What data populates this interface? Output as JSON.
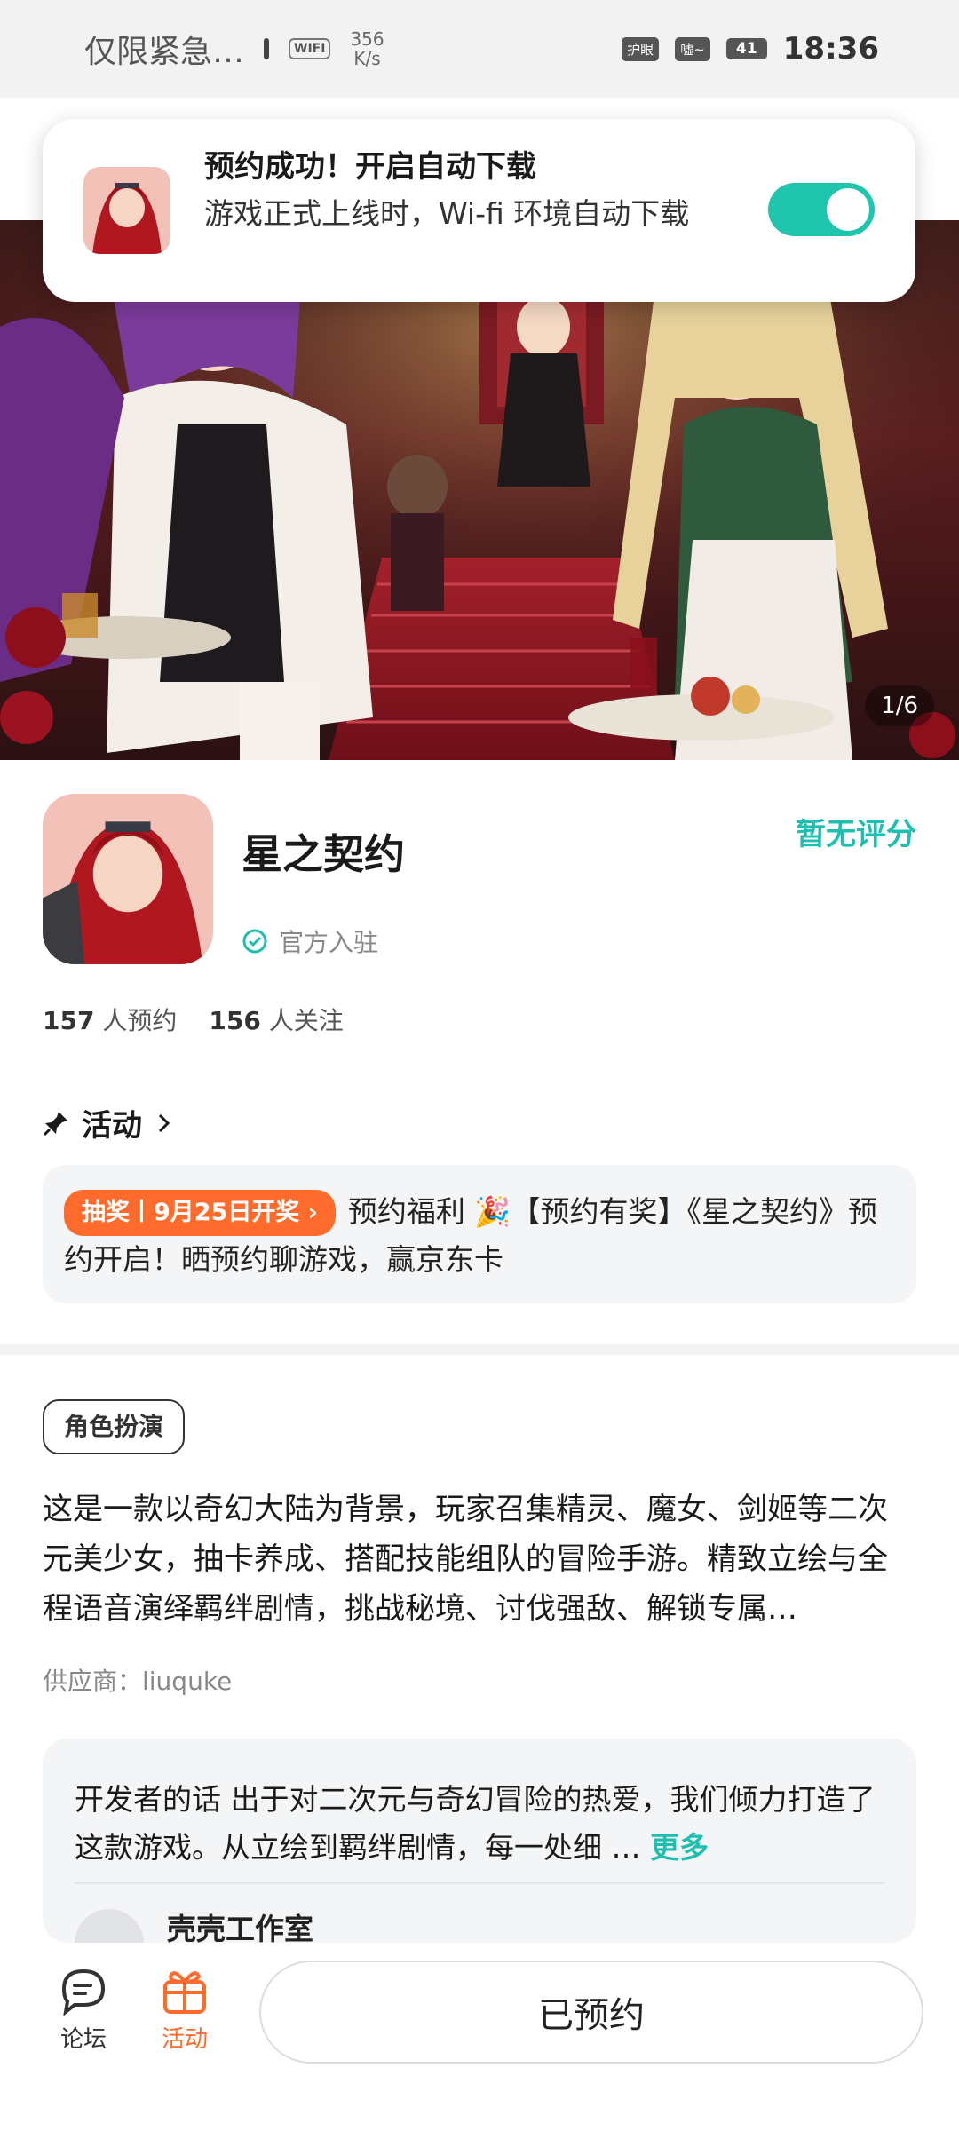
{
  "status_bar": {
    "carrier": "仅限紧急…",
    "wifi": "WIFI",
    "speed_value": "356",
    "speed_unit": "K/s",
    "badge_eye": "护眼",
    "badge_signal": "嘘~",
    "battery": "41",
    "time": "18:36"
  },
  "toast": {
    "title": "预约成功！开启自动下载",
    "body": "游戏正式上线时，Wi-fi 环境自动下载",
    "toggle_on": true
  },
  "hero": {
    "counter": "1/6"
  },
  "game": {
    "name": "星之契约",
    "rating": "暂无评分",
    "official": "官方入驻",
    "reservations_count": "157",
    "reservations_label": "人预约",
    "follows_count": "156",
    "follows_label": "人关注"
  },
  "activity": {
    "heading": "活动",
    "tag": "抽奖丨9月25日开奖 ›",
    "text": "预约福利 🎉【预约有奖】《星之契约》预约开启！晒预约聊游戏，赢京东卡"
  },
  "details": {
    "genre": "角色扮演",
    "description": "这是一款以奇幻大陆为背景，玩家召集精灵、魔女、剑姬等二次元美少女，抽卡养成、搭配技能组队的冒险手游。精致立绘与全程语音演绎羁绊剧情，挑战秘境、讨伐强敌、解锁专属…",
    "supplier": "供应商：liuquke"
  },
  "developer": {
    "text": "开发者的话  出于对二次元与奇幻冒险的热爱，我们倾力打造了这款游戏。从立绘到羁绊剧情，每一处细 …",
    "more": "更多",
    "studio": "壳壳工作室"
  },
  "bottom_nav": {
    "forum": "论坛",
    "activity": "活动",
    "reserve_button": "已预约"
  },
  "colors": {
    "accent": "#1fbfb0",
    "orange": "#ff6b2c"
  }
}
